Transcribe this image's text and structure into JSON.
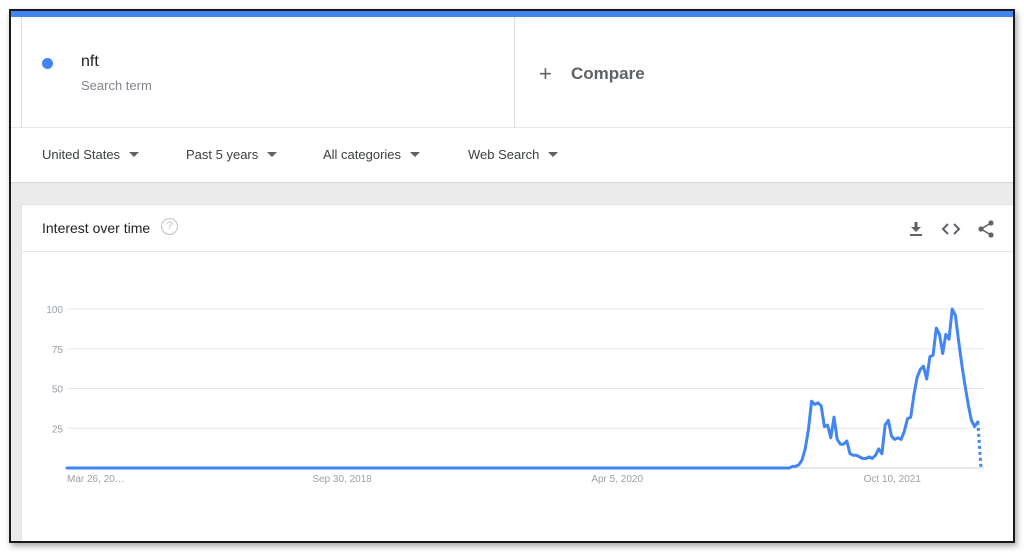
{
  "search_term": {
    "name": "nft",
    "subtitle": "Search term",
    "color": "#4285f4"
  },
  "compare": {
    "icon": "plus-icon",
    "label": "Compare"
  },
  "filters": [
    {
      "label": "United States"
    },
    {
      "label": "Past 5 years"
    },
    {
      "label": "All categories"
    },
    {
      "label": "Web Search"
    }
  ],
  "card": {
    "title": "Interest over time",
    "icons": [
      "help-icon",
      "download-icon",
      "embed-code-icon",
      "share-icon"
    ]
  },
  "chart_data": {
    "type": "line",
    "title": "Interest over time",
    "y_ticks": [
      25,
      50,
      75,
      100
    ],
    "ylim": [
      0,
      100
    ],
    "x_tick_labels": [
      "Mar 26, 20…",
      "Sep 30, 2018",
      "Apr 5, 2020",
      "Oct 10, 2021"
    ],
    "x_tick_positions": [
      0,
      0.3,
      0.6,
      0.9
    ],
    "grid": true,
    "series": [
      {
        "color": "#4285f4",
        "values": [
          0,
          0,
          0,
          0,
          0,
          0,
          0,
          0,
          0,
          0,
          0,
          0,
          0,
          0,
          0,
          0,
          0,
          0,
          0,
          0,
          0,
          0,
          0,
          0,
          0,
          0,
          0,
          0,
          0,
          0,
          0,
          0,
          0,
          0,
          0,
          0,
          0,
          0,
          0,
          0,
          0,
          0,
          0,
          0,
          0,
          0,
          0,
          0,
          0,
          0,
          0,
          0,
          0,
          0,
          0,
          0,
          0,
          0,
          0,
          0,
          0,
          0,
          0,
          0,
          0,
          0,
          0,
          0,
          0,
          0,
          0,
          0,
          0,
          0,
          0,
          0,
          0,
          0,
          0,
          0,
          0,
          0,
          0,
          0,
          0,
          0,
          0,
          0,
          0,
          0,
          0,
          0,
          0,
          0,
          0,
          0,
          0,
          0,
          0,
          0,
          0,
          0,
          0,
          0,
          0,
          0,
          0,
          0,
          0,
          0,
          0,
          0,
          0,
          0,
          0,
          0,
          0,
          0,
          0,
          0,
          0,
          0,
          0,
          0,
          0,
          0,
          0,
          0,
          0,
          0,
          0,
          0,
          0,
          0,
          0,
          0,
          0,
          0,
          0,
          0,
          0,
          0,
          0,
          0,
          0,
          0,
          0,
          0,
          0,
          0,
          0,
          0,
          0,
          0,
          0,
          0,
          0,
          0,
          0,
          0,
          0,
          0,
          0,
          0,
          0,
          0,
          0,
          0,
          0,
          0,
          0,
          0,
          0,
          0,
          0,
          0,
          0,
          0,
          0,
          0,
          0,
          0,
          0,
          0,
          0,
          0,
          0,
          0,
          0,
          0,
          0,
          0,
          0,
          0,
          0,
          0,
          0,
          0,
          0,
          0,
          0,
          0,
          0,
          0,
          0,
          0,
          0,
          0,
          0,
          0,
          0,
          0,
          0,
          0,
          0,
          0,
          0,
          0,
          0,
          0,
          0,
          0,
          0,
          0,
          0,
          0,
          0,
          1,
          1,
          2,
          5,
          12,
          24,
          42,
          40,
          41,
          39,
          26,
          27,
          19,
          32,
          18,
          15,
          15,
          17,
          9,
          8,
          8,
          7,
          6,
          6,
          7,
          6,
          8,
          12,
          9,
          27,
          30,
          20,
          18,
          19,
          18,
          23,
          31,
          32,
          46,
          57,
          62,
          64,
          56,
          70,
          71,
          88,
          84,
          72,
          84,
          81,
          100,
          96,
          80,
          65,
          52,
          40,
          30,
          26,
          29
        ],
        "partial_tail": [
          29,
          0
        ]
      }
    ]
  }
}
